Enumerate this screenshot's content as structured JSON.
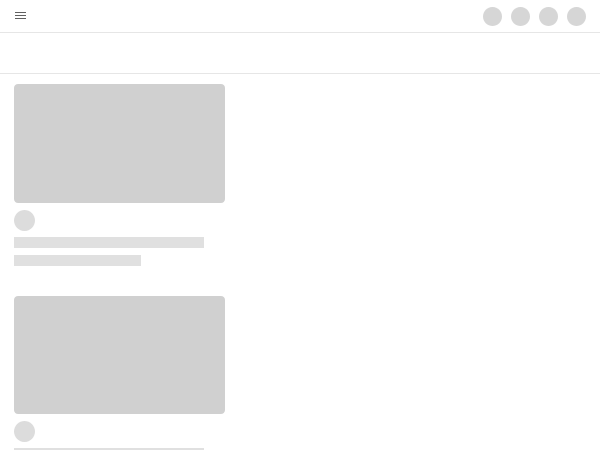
{
  "header": {
    "menu_icon": "hamburger-menu-icon",
    "action_icons": [
      "placeholder-circle-icon",
      "placeholder-circle-icon",
      "placeholder-circle-icon",
      "placeholder-circle-icon"
    ]
  },
  "feed": {
    "items": [
      {
        "state": "loading-skeleton"
      },
      {
        "state": "loading-skeleton"
      }
    ]
  },
  "colors": {
    "background": "#ffffff",
    "skeleton_thumbnail": "#d0d0d0",
    "skeleton_avatar": "#dcdcdc",
    "skeleton_text": "#e0e0e0",
    "divider": "#e6e6e6",
    "icon": "#606060"
  }
}
